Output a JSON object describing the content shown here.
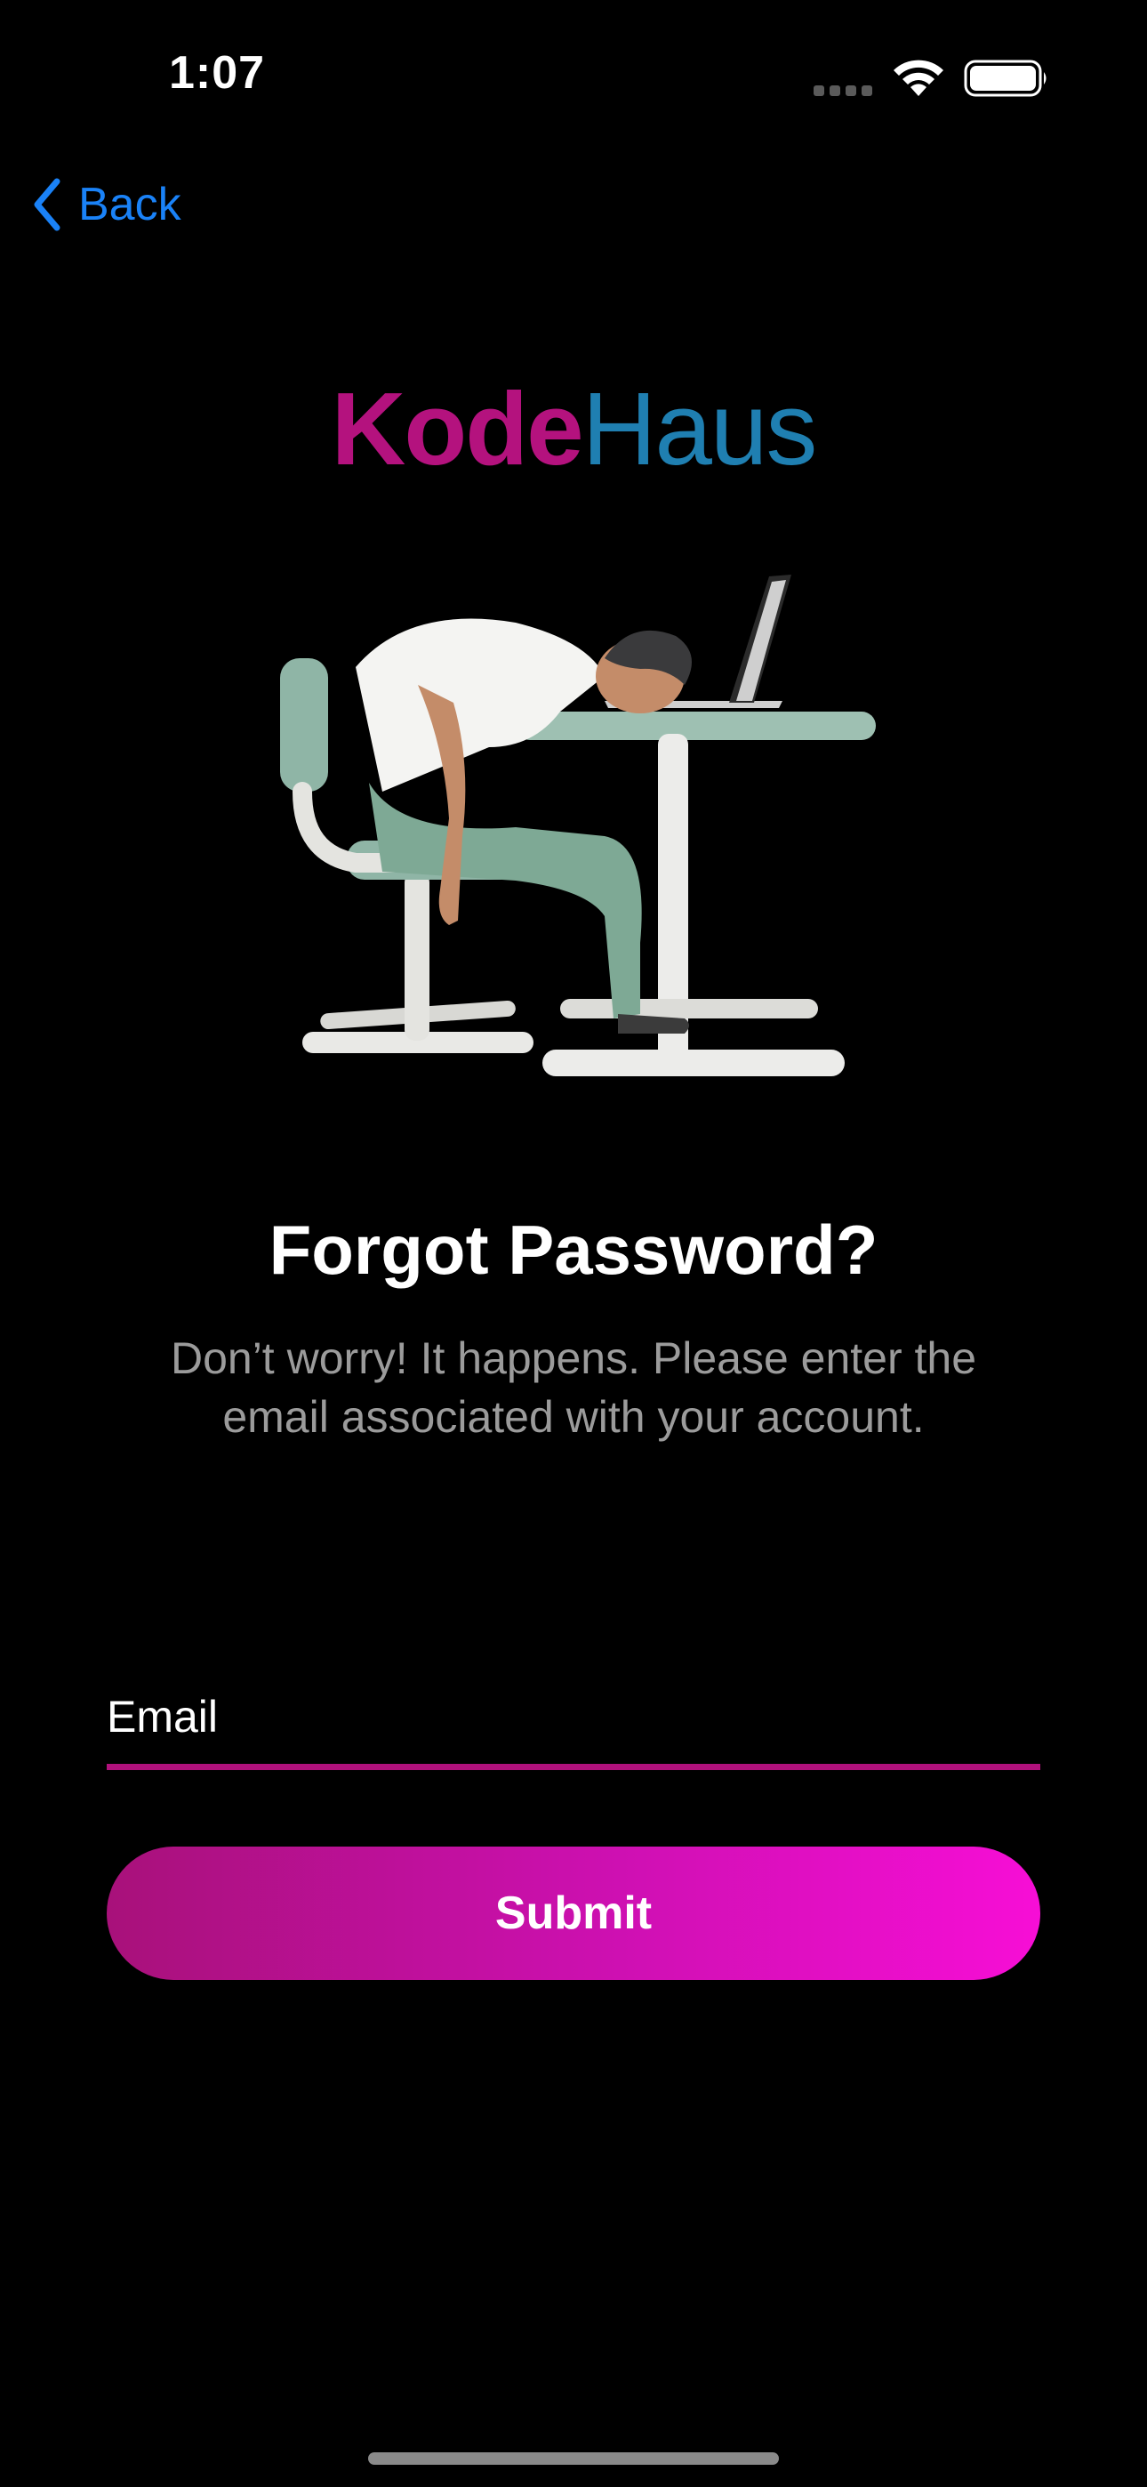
{
  "status_bar": {
    "time": "1:07"
  },
  "nav": {
    "back_label": "Back",
    "accent_color": "#1a82f7"
  },
  "logo": {
    "part1": "Kode",
    "part2": "Haus",
    "part1_color": "#b4127e",
    "part2_color": "#1f7fb1"
  },
  "content": {
    "title": "Forgot Password?",
    "subtitle": "Don’t worry! It happens. Please enter the email associated with your account."
  },
  "form": {
    "email_placeholder": "Email",
    "email_value": "",
    "submit_label": "Submit",
    "accent_color": "#b0117c"
  }
}
